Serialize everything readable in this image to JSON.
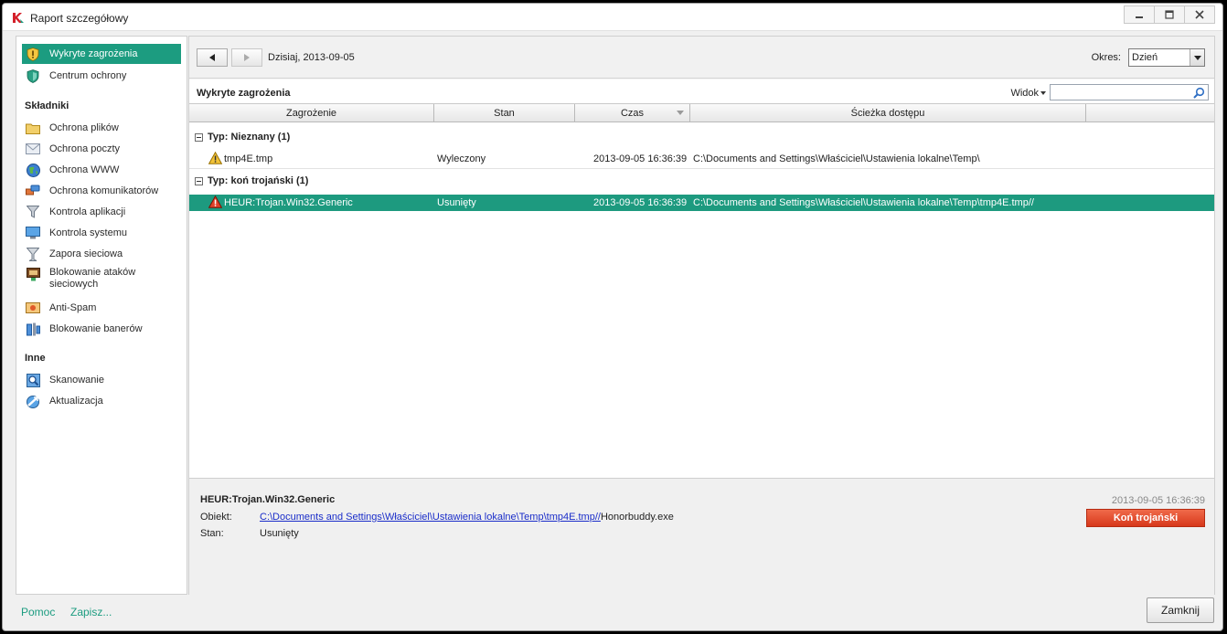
{
  "window": {
    "title": "Raport szczegółowy"
  },
  "sidebar": {
    "top_items": [
      {
        "label": "Wykryte zagrożenia",
        "icon": "shield-warning-icon",
        "active": true
      },
      {
        "label": "Centrum ochrony",
        "icon": "shield-icon",
        "active": false
      }
    ],
    "components_header": "Składniki",
    "components": [
      {
        "label": "Ochrona plików",
        "icon": "folder-icon"
      },
      {
        "label": "Ochrona poczty",
        "icon": "mail-icon"
      },
      {
        "label": "Ochrona WWW",
        "icon": "globe-icon"
      },
      {
        "label": "Ochrona komunikatorów",
        "icon": "messenger-icon"
      },
      {
        "label": "Kontrola aplikacji",
        "icon": "funnel-icon"
      },
      {
        "label": "Kontrola systemu",
        "icon": "monitor-icon"
      },
      {
        "label": "Zapora sieciowa",
        "icon": "firewall-icon"
      },
      {
        "label_line1": "Blokowanie ataków",
        "label_line2": "sieciowych",
        "icon": "network-attack-icon"
      },
      {
        "label": "Anti-Spam",
        "icon": "antispam-icon"
      },
      {
        "label": "Blokowanie banerów",
        "icon": "banner-block-icon"
      }
    ],
    "other_header": "Inne",
    "other": [
      {
        "label": "Skanowanie",
        "icon": "scan-icon"
      },
      {
        "label": "Aktualizacja",
        "icon": "update-icon"
      }
    ]
  },
  "toolbar": {
    "date_label": "Dzisiaj, 2013-09-05",
    "period_label": "Okres:",
    "period_value": "Dzień"
  },
  "list": {
    "title": "Wykryte zagrożenia",
    "view_label": "Widok",
    "search_value": "",
    "columns": [
      "Zagrożenie",
      "Stan",
      "Czas",
      "Ścieżka dostępu"
    ],
    "groups": [
      {
        "label": "Typ: Nieznany (1)",
        "rows": [
          {
            "threat": "tmp4E.tmp",
            "status": "Wyleczony",
            "time": "2013-09-05 16:36:39",
            "path": "C:\\Documents and Settings\\Właściciel\\Ustawienia lokalne\\Temp\\",
            "severity": "warning",
            "selected": false
          }
        ]
      },
      {
        "label": "Typ: koń trojański (1)",
        "rows": [
          {
            "threat": "HEUR:Trojan.Win32.Generic",
            "status": "Usunięty",
            "time": "2013-09-05 16:36:39",
            "path": "C:\\Documents and Settings\\Właściciel\\Ustawienia lokalne\\Temp\\tmp4E.tmp//",
            "severity": "danger",
            "selected": true
          }
        ]
      }
    ]
  },
  "details": {
    "title": "HEUR:Trojan.Win32.Generic",
    "time": "2013-09-05 16:36:39",
    "object_label": "Obiekt:",
    "object_link": "C:\\Documents and Settings\\Właściciel\\Ustawienia lokalne\\Temp\\tmp4E.tmp//",
    "object_suffix": "Honorbuddy.exe",
    "status_label": "Stan:",
    "status_value": "Usunięty",
    "threat_type_badge": "Koń trojański"
  },
  "footer": {
    "help_link": "Pomoc",
    "save_link": "Zapisz...",
    "close_button": "Zamknij"
  },
  "colors": {
    "accent": "#1c9c80",
    "selected_row": "#1d9a7f",
    "danger_badge": "#e04a2b",
    "link": "#1a2dc9"
  }
}
